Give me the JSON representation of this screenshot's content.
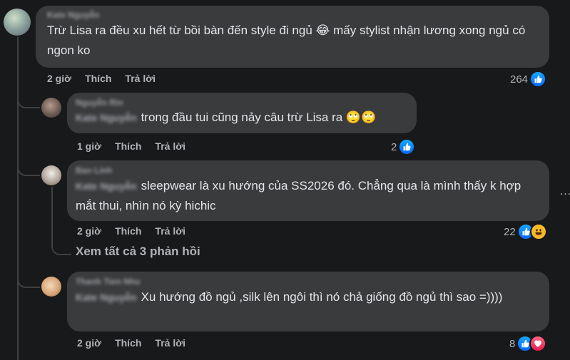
{
  "comments": [
    {
      "author": "Kate Nguyễn",
      "text": "Trừ Lisa ra đều xu hết từ bồi bàn đến style đi ngủ 😂 mấy stylist nhận lương xong ngủ có ngon ko",
      "time": "2 giờ",
      "like": "Thích",
      "reply": "Trả lời",
      "reactions": "264"
    },
    {
      "author": "Nguyễn Rin",
      "mention": "Kate Nguyễn",
      "text": "trong đầu tui cũng nảy câu trừ Lisa ra 🙄🙄",
      "time": "1 giờ",
      "like": "Thích",
      "reply": "Trả lời",
      "reactions": "2"
    },
    {
      "author": "Bao Linh",
      "mention": "Kate Nguyễn",
      "text": "sleepwear là xu hướng của SS2026 đó. Chẳng qua là mình thấy k hợp mắt thui, nhìn nó kỳ hichic",
      "time": "2 giờ",
      "like": "Thích",
      "reply": "Trả lời",
      "reactions": "22"
    },
    {
      "author": "Thanh Tien Nhu",
      "mention": "Kate Nguyễn",
      "text": "Xu hướng đồ ngủ ,silk lên ngôi thì nó chả giống đồ ngủ thì sao =))))",
      "time": "2 giờ",
      "like": "Thích",
      "reply": "Trả lời",
      "reactions": "8"
    }
  ],
  "view_more": "Xem tất cả 3 phản hồi",
  "more_menu": "…",
  "colors": {
    "background": "#18191a",
    "bubble": "#3a3b3c",
    "meta": "#b0b3b8",
    "like": "#0766ff",
    "love": "#e61e4d",
    "haha": "#f7b928"
  },
  "icons": [
    "like-reaction-icon",
    "haha-reaction-icon",
    "love-reaction-icon"
  ]
}
